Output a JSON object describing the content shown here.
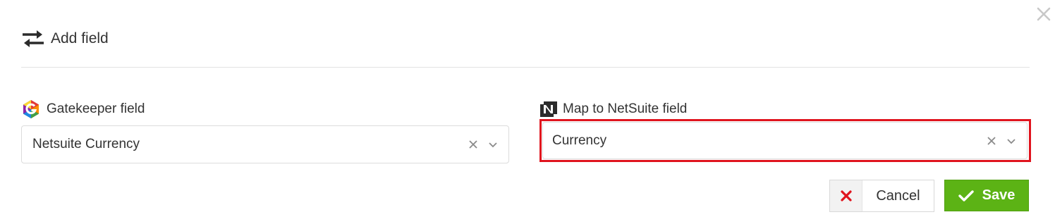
{
  "dialog": {
    "title": "Add field",
    "close_icon": "close-icon",
    "title_icon": "swap-arrows-icon"
  },
  "gatekeeper": {
    "label": "Gatekeeper field",
    "icon": "gatekeeper-logo",
    "value": "Netsuite Currency"
  },
  "netsuite": {
    "label": "Map to NetSuite field",
    "icon": "netsuite-logo",
    "value": "Currency",
    "highlight_color": "#e0141e"
  },
  "actions": {
    "cancel_label": "Cancel",
    "save_label": "Save",
    "save_color": "#5cb315",
    "cancel_icon_color": "#e0141e"
  }
}
